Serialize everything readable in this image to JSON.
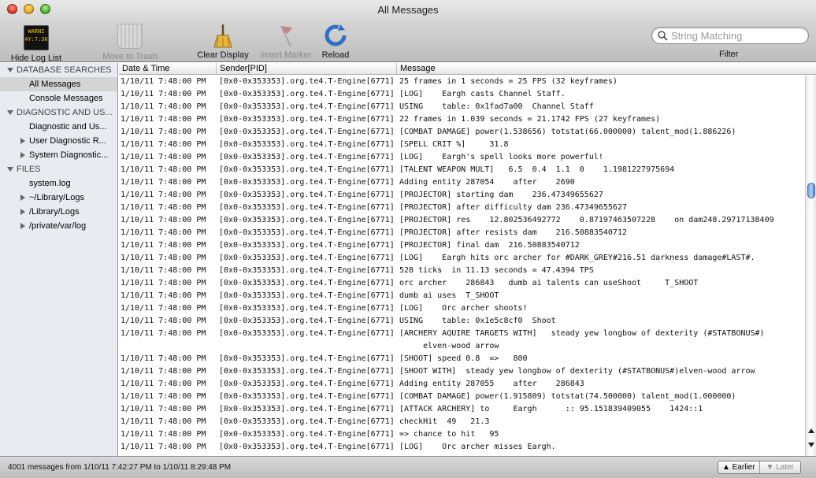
{
  "window": {
    "title": "All Messages"
  },
  "toolbar": {
    "hide_log_list": "Hide Log List",
    "hide_log_list_icon_text": "WARNI\n4Y:7:36",
    "move_to_trash": "Move to Trash",
    "clear_display": "Clear Display",
    "insert_marker": "Insert Marker",
    "reload": "Reload",
    "search_placeholder": "String Matching",
    "filter_label": "Filter"
  },
  "sidebar": {
    "sections": [
      {
        "label": "DATABASE SEARCHES",
        "items": [
          {
            "label": "All Messages",
            "selected": true,
            "expandable": false
          },
          {
            "label": "Console Messages",
            "selected": false,
            "expandable": false
          }
        ]
      },
      {
        "label": "DIAGNOSTIC AND US...",
        "items": [
          {
            "label": "Diagnostic and Us...",
            "selected": false,
            "expandable": false
          },
          {
            "label": "User Diagnostic R...",
            "selected": false,
            "expandable": true
          },
          {
            "label": "System Diagnostic...",
            "selected": false,
            "expandable": true
          }
        ]
      },
      {
        "label": "FILES",
        "items": [
          {
            "label": "system.log",
            "selected": false,
            "expandable": false
          },
          {
            "label": "~/Library/Logs",
            "selected": false,
            "expandable": true
          },
          {
            "label": "/Library/Logs",
            "selected": false,
            "expandable": true
          },
          {
            "label": "/private/var/log",
            "selected": false,
            "expandable": true
          }
        ]
      }
    ]
  },
  "table": {
    "columns": [
      "Date & Time",
      "Sender[PID]",
      "Message"
    ],
    "rows": [
      {
        "date": "1/10/11 7:48:00 PM",
        "sender": "[0x0-0x353353].org.te4.T-Engine[6771]",
        "message": "25 frames in 1 seconds = 25 FPS (32 keyframes)"
      },
      {
        "date": "1/10/11 7:48:00 PM",
        "sender": "[0x0-0x353353].org.te4.T-Engine[6771]",
        "message": "[LOG]    Eargh casts Channel Staff."
      },
      {
        "date": "1/10/11 7:48:00 PM",
        "sender": "[0x0-0x353353].org.te4.T-Engine[6771]",
        "message": "USING    table: 0x1fad7a00  Channel Staff"
      },
      {
        "date": "1/10/11 7:48:00 PM",
        "sender": "[0x0-0x353353].org.te4.T-Engine[6771]",
        "message": "22 frames in 1.039 seconds = 21.1742 FPS (27 keyframes)"
      },
      {
        "date": "1/10/11 7:48:00 PM",
        "sender": "[0x0-0x353353].org.te4.T-Engine[6771]",
        "message": "[COMBAT DAMAGE] power(1.538656) totstat(66.000000) talent_mod(1.886226)"
      },
      {
        "date": "1/10/11 7:48:00 PM",
        "sender": "[0x0-0x353353].org.te4.T-Engine[6771]",
        "message": "[SPELL CRIT %]     31.8"
      },
      {
        "date": "1/10/11 7:48:00 PM",
        "sender": "[0x0-0x353353].org.te4.T-Engine[6771]",
        "message": "[LOG]    Eargh's spell looks more powerful!"
      },
      {
        "date": "1/10/11 7:48:00 PM",
        "sender": "[0x0-0x353353].org.te4.T-Engine[6771]",
        "message": "[TALENT WEAPON MULT]   6.5  0.4  1.1  0    1.1981227975694"
      },
      {
        "date": "1/10/11 7:48:00 PM",
        "sender": "[0x0-0x353353].org.te4.T-Engine[6771]",
        "message": "Adding entity 287054    after    2690"
      },
      {
        "date": "1/10/11 7:48:00 PM",
        "sender": "[0x0-0x353353].org.te4.T-Engine[6771]",
        "message": "[PROJECTOR] starting dam    236.47349655627"
      },
      {
        "date": "1/10/11 7:48:00 PM",
        "sender": "[0x0-0x353353].org.te4.T-Engine[6771]",
        "message": "[PROJECTOR] after difficulty dam 236.47349655627"
      },
      {
        "date": "1/10/11 7:48:00 PM",
        "sender": "[0x0-0x353353].org.te4.T-Engine[6771]",
        "message": "[PROJECTOR] res    12.802536492772    0.87197463507228    on dam248.29717138409"
      },
      {
        "date": "1/10/11 7:48:00 PM",
        "sender": "[0x0-0x353353].org.te4.T-Engine[6771]",
        "message": "[PROJECTOR] after resists dam    216.50883540712"
      },
      {
        "date": "1/10/11 7:48:00 PM",
        "sender": "[0x0-0x353353].org.te4.T-Engine[6771]",
        "message": "[PROJECTOR] final dam  216.50883540712"
      },
      {
        "date": "1/10/11 7:48:00 PM",
        "sender": "[0x0-0x353353].org.te4.T-Engine[6771]",
        "message": "[LOG]    Eargh hits orc archer for #DARK_GREY#216.51 darkness damage#LAST#."
      },
      {
        "date": "1/10/11 7:48:00 PM",
        "sender": "[0x0-0x353353].org.te4.T-Engine[6771]",
        "message": "528 ticks  in 11.13 seconds = 47.4394 TPS"
      },
      {
        "date": "1/10/11 7:48:00 PM",
        "sender": "[0x0-0x353353].org.te4.T-Engine[6771]",
        "message": "orc archer    286843   dumb ai talents can useShoot     T_SHOOT"
      },
      {
        "date": "1/10/11 7:48:00 PM",
        "sender": "[0x0-0x353353].org.te4.T-Engine[6771]",
        "message": "dumb ai uses  T_SHOOT"
      },
      {
        "date": "1/10/11 7:48:00 PM",
        "sender": "[0x0-0x353353].org.te4.T-Engine[6771]",
        "message": "[LOG]    Orc archer shoots!"
      },
      {
        "date": "1/10/11 7:48:00 PM",
        "sender": "[0x0-0x353353].org.te4.T-Engine[6771]",
        "message": "USING    table: 0x1e5c8cf0  Shoot"
      },
      {
        "date": "1/10/11 7:48:00 PM",
        "sender": "[0x0-0x353353].org.te4.T-Engine[6771]",
        "message": "[ARCHERY AQUIRE TARGETS WITH]   steady yew longbow of dexterity (#STATBONUS#)\n     elven-wood arrow"
      },
      {
        "date": "1/10/11 7:48:00 PM",
        "sender": "[0x0-0x353353].org.te4.T-Engine[6771]",
        "message": "[SHOOT] speed 0.8  =>   800"
      },
      {
        "date": "1/10/11 7:48:00 PM",
        "sender": "[0x0-0x353353].org.te4.T-Engine[6771]",
        "message": "[SHOOT WITH]  steady yew longbow of dexterity (#STATBONUS#)elven-wood arrow"
      },
      {
        "date": "1/10/11 7:48:00 PM",
        "sender": "[0x0-0x353353].org.te4.T-Engine[6771]",
        "message": "Adding entity 287055    after    286843"
      },
      {
        "date": "1/10/11 7:48:00 PM",
        "sender": "[0x0-0x353353].org.te4.T-Engine[6771]",
        "message": "[COMBAT DAMAGE] power(1.915809) totstat(74.500000) talent_mod(1.000000)"
      },
      {
        "date": "1/10/11 7:48:00 PM",
        "sender": "[0x0-0x353353].org.te4.T-Engine[6771]",
        "message": "[ATTACK ARCHERY] to     Eargh      :: 95.151839409055    1424::1"
      },
      {
        "date": "1/10/11 7:48:00 PM",
        "sender": "[0x0-0x353353].org.te4.T-Engine[6771]",
        "message": "checkHit  49   21.3"
      },
      {
        "date": "1/10/11 7:48:00 PM",
        "sender": "[0x0-0x353353].org.te4.T-Engine[6771]",
        "message": "=> chance to hit   95"
      },
      {
        "date": "1/10/11 7:48:00 PM",
        "sender": "[0x0-0x353353].org.te4.T-Engine[6771]",
        "message": "[LOG]    Orc archer misses Eargh."
      }
    ]
  },
  "statusbar": {
    "text": "4001 messages from 1/10/11 7:42:27 PM to 1/10/11 8:29:48 PM",
    "earlier": "▲ Earlier",
    "later": "▼ Later"
  },
  "colors": {
    "selection": "#d4d4d4",
    "sidebar_bg": "#e8ecf1",
    "scroll_thumb": "#6f98d3"
  }
}
